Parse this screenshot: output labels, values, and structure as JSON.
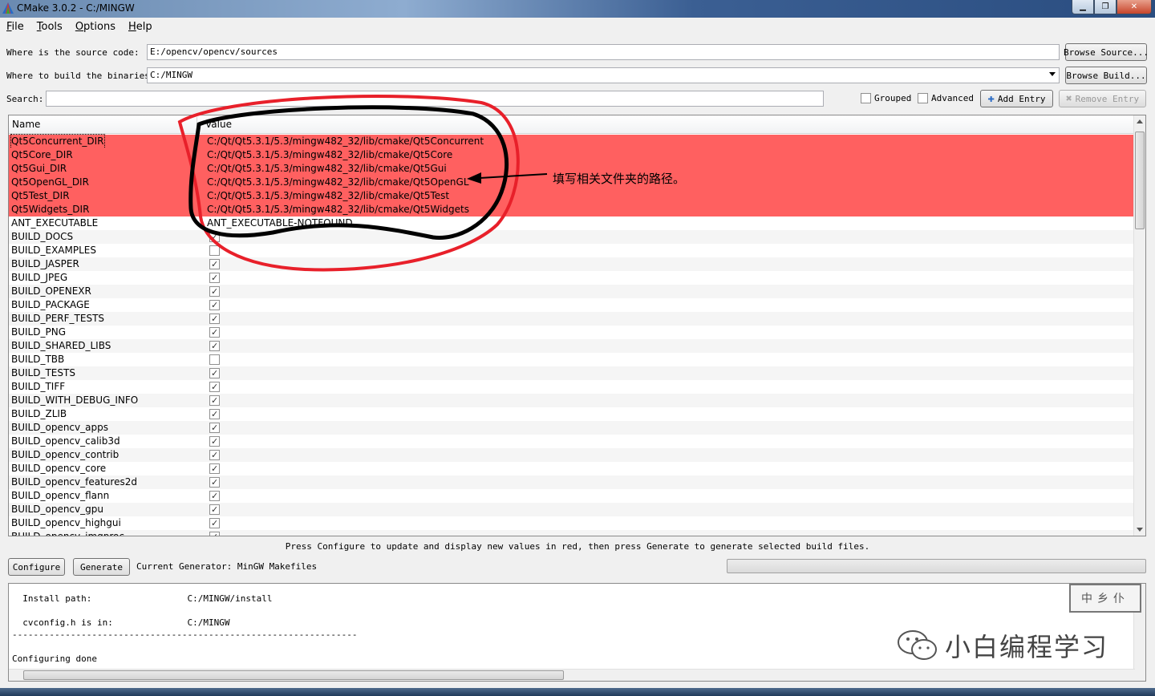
{
  "window": {
    "title": "CMake 3.0.2 - C:/MINGW"
  },
  "menu": [
    "File",
    "Tools",
    "Options",
    "Help"
  ],
  "source": {
    "label": "Where is the source code:",
    "value": "E:/opencv/opencv/sources",
    "browse": "Browse Source..."
  },
  "build": {
    "label": "Where to build the binaries:",
    "value": "C:/MINGW",
    "browse": "Browse Build..."
  },
  "search": {
    "label": "Search:",
    "value": ""
  },
  "options": {
    "grouped": "Grouped",
    "advanced": "Advanced",
    "add_entry": "Add Entry",
    "remove_entry": "Remove Entry"
  },
  "table": {
    "col_name": "Name",
    "col_value": "Value",
    "rows": [
      {
        "name": "Qt5Concurrent_DIR",
        "value": "C:/Qt/Qt5.3.1/5.3/mingw482_32/lib/cmake/Qt5Concurrent",
        "red": true
      },
      {
        "name": "Qt5Core_DIR",
        "value": "C:/Qt/Qt5.3.1/5.3/mingw482_32/lib/cmake/Qt5Core",
        "red": true
      },
      {
        "name": "Qt5Gui_DIR",
        "value": "C:/Qt/Qt5.3.1/5.3/mingw482_32/lib/cmake/Qt5Gui",
        "red": true
      },
      {
        "name": "Qt5OpenGL_DIR",
        "value": "C:/Qt/Qt5.3.1/5.3/mingw482_32/lib/cmake/Qt5OpenGL",
        "red": true
      },
      {
        "name": "Qt5Test_DIR",
        "value": "C:/Qt/Qt5.3.1/5.3/mingw482_32/lib/cmake/Qt5Test",
        "red": true
      },
      {
        "name": "Qt5Widgets_DIR",
        "value": "C:/Qt/Qt5.3.1/5.3/mingw482_32/lib/cmake/Qt5Widgets",
        "red": true
      },
      {
        "name": "ANT_EXECUTABLE",
        "value": "ANT_EXECUTABLE-NOTFOUND"
      },
      {
        "name": "BUILD_DOCS",
        "checked": true
      },
      {
        "name": "BUILD_EXAMPLES",
        "checked": false
      },
      {
        "name": "BUILD_JASPER",
        "checked": true
      },
      {
        "name": "BUILD_JPEG",
        "checked": true
      },
      {
        "name": "BUILD_OPENEXR",
        "checked": true
      },
      {
        "name": "BUILD_PACKAGE",
        "checked": true
      },
      {
        "name": "BUILD_PERF_TESTS",
        "checked": true
      },
      {
        "name": "BUILD_PNG",
        "checked": true
      },
      {
        "name": "BUILD_SHARED_LIBS",
        "checked": true
      },
      {
        "name": "BUILD_TBB",
        "checked": false
      },
      {
        "name": "BUILD_TESTS",
        "checked": true
      },
      {
        "name": "BUILD_TIFF",
        "checked": true
      },
      {
        "name": "BUILD_WITH_DEBUG_INFO",
        "checked": true
      },
      {
        "name": "BUILD_ZLIB",
        "checked": true
      },
      {
        "name": "BUILD_opencv_apps",
        "checked": true
      },
      {
        "name": "BUILD_opencv_calib3d",
        "checked": true
      },
      {
        "name": "BUILD_opencv_contrib",
        "checked": true
      },
      {
        "name": "BUILD_opencv_core",
        "checked": true
      },
      {
        "name": "BUILD_opencv_features2d",
        "checked": true
      },
      {
        "name": "BUILD_opencv_flann",
        "checked": true
      },
      {
        "name": "BUILD_opencv_gpu",
        "checked": true
      },
      {
        "name": "BUILD_opencv_highgui",
        "checked": true
      },
      {
        "name": "BUILD_opencv_imgproc",
        "checked": true
      }
    ]
  },
  "hint": "Press Configure to update and display new values in red,  then press Generate to generate selected build files.",
  "actions": {
    "configure": "Configure",
    "generate": "Generate",
    "generator": "Current Generator: MinGW Makefiles"
  },
  "output": {
    "lines": [
      "  Install path:                  C:/MINGW/install",
      "",
      "  cvconfig.h is in:              C:/MINGW",
      "-----------------------------------------------------------------",
      "",
      "Configuring done"
    ]
  },
  "annotation": {
    "note": "填写相关文件夹的路径。",
    "circle_color": "#e8202a",
    "ink_color": "#000000"
  },
  "watermark": {
    "text": "小白编程学习",
    "stamp": "中乡仆"
  },
  "colors": {
    "changed_row": "#ff6060"
  }
}
